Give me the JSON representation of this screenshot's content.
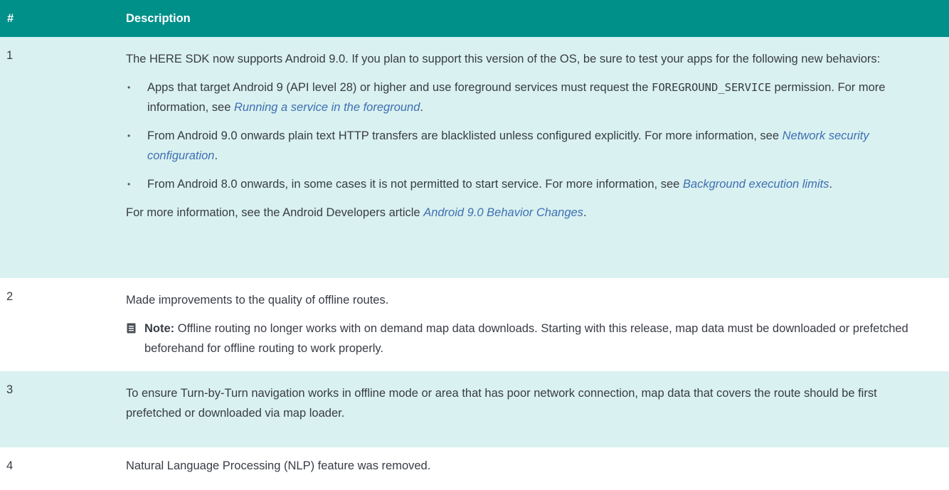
{
  "header": {
    "col_num": "#",
    "col_desc": "Description"
  },
  "rows": [
    {
      "num": "1",
      "intro": "The HERE SDK now supports Android 9.0. If you plan to support this version of the OS, be sure to test your apps for the following new behaviors:",
      "bullets": [
        {
          "text_a": "Apps that target Android 9 (API level 28) or higher and use foreground services must request the ",
          "code": "FOREGROUND_SERVICE",
          "text_b": " permission. For more information, see ",
          "link": "Running a service in the foreground",
          "text_c": "."
        },
        {
          "text_a": "From Android 9.0 onwards plain text HTTP transfers are blacklisted unless configured explicitly. For more information, see ",
          "link": "Network security configuration",
          "text_c": "."
        },
        {
          "text_a": "From Android 8.0 onwards, in some cases it is not permitted to start service. For more information, see ",
          "link": "Background execution limits",
          "text_c": "."
        }
      ],
      "outro_a": "For more information, see the Android Developers article ",
      "outro_link": "Android 9.0 Behavior Changes",
      "outro_b": "."
    },
    {
      "num": "2",
      "text": "Made improvements to the quality of offline routes.",
      "note_label": "Note:",
      "note_text": " Offline routing no longer works with on demand map data downloads. Starting with this release, map data must be downloaded or prefetched beforehand for offline routing to work properly.",
      "note_icon": "note-icon"
    },
    {
      "num": "3",
      "text": "To ensure Turn-by-Turn navigation works in offline mode or area that has poor network connection, map data that covers the route should be first prefetched or downloaded via map loader."
    },
    {
      "num": "4",
      "text": "Natural Language Processing (NLP) feature was removed."
    }
  ],
  "colors": {
    "header_bg": "#00908a",
    "alt_row_bg": "#d9f1f0",
    "link": "#3f6fb3"
  }
}
